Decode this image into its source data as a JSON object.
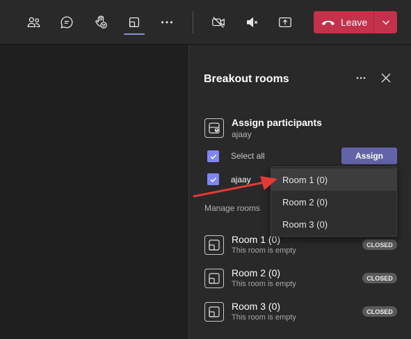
{
  "toolbar": {
    "icons": [
      "people-icon",
      "chat-icon",
      "raise-hand-icon",
      "breakout-rooms-icon",
      "more-icon",
      "camera-off-icon",
      "mic-mute-icon",
      "share-icon"
    ],
    "leave_label": "Leave",
    "leave_color": "#c4314b"
  },
  "panel": {
    "title": "Breakout rooms",
    "assign": {
      "title": "Assign participants",
      "subtitle": "ajaay",
      "select_all_label": "Select all",
      "participant_label": "ajaay",
      "button_label": "Assign"
    },
    "manage_label": "Manage rooms",
    "rooms": [
      {
        "name": "Room 1 (0)",
        "status": "This room is empty",
        "badge": "CLOSED"
      },
      {
        "name": "Room 2 (0)",
        "status": "This room is empty",
        "badge": "CLOSED"
      },
      {
        "name": "Room 3 (0)",
        "status": "This room is empty",
        "badge": "CLOSED"
      }
    ]
  },
  "dropdown": {
    "options": [
      "Room 1 (0)",
      "Room 2 (0)",
      "Room 3 (0)"
    ],
    "highlighted_index": 0
  },
  "annotation": {
    "arrow_color": "#e53935"
  },
  "colors": {
    "accent": "#6264a7",
    "checkbox": "#7f85f5"
  }
}
